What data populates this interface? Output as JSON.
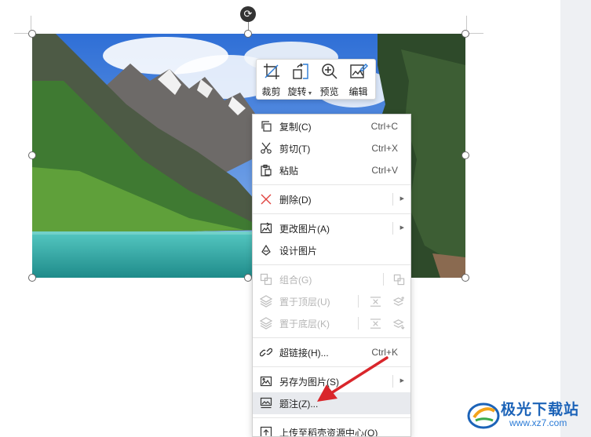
{
  "toolbar": {
    "buttons": [
      {
        "label": "裁剪",
        "icon": "crop-icon"
      },
      {
        "label": "旋转",
        "icon": "rotate-icon",
        "has_dropdown": true
      },
      {
        "label": "预览",
        "icon": "zoom-icon"
      },
      {
        "label": "编辑",
        "icon": "edit-image-icon"
      }
    ]
  },
  "context_menu": {
    "items": [
      {
        "label": "复制(C)",
        "shortcut": "Ctrl+C",
        "icon": "copy-icon"
      },
      {
        "label": "剪切(T)",
        "shortcut": "Ctrl+X",
        "icon": "scissors-icon"
      },
      {
        "label": "粘贴",
        "shortcut": "Ctrl+V",
        "icon": "paste-icon"
      },
      {
        "label": "删除(D)",
        "icon": "delete-x-icon",
        "submenu": true
      },
      {
        "label": "更改图片(A)",
        "icon": "change-image-icon",
        "submenu": true
      },
      {
        "label": "设计图片",
        "icon": "design-icon"
      },
      {
        "label": "组合(G)",
        "icon": "group-icon",
        "disabled": true
      },
      {
        "label": "置于顶层(U)",
        "icon": "layers-icon",
        "disabled": true
      },
      {
        "label": "置于底层(K)",
        "icon": "layers-icon",
        "disabled": true
      },
      {
        "label": "超链接(H)...",
        "shortcut": "Ctrl+K",
        "icon": "link-icon"
      },
      {
        "label": "另存为图片(S)",
        "icon": "save-image-icon",
        "submenu": true
      },
      {
        "label": "题注(Z)...",
        "icon": "caption-icon",
        "highlighted": true
      },
      {
        "label": "上传至稻壳资源中心(Q)",
        "icon": "upload-icon"
      }
    ]
  },
  "watermark": {
    "title": "极光下载站",
    "url": "www.xz7.com"
  },
  "colors": {
    "annotation_arrow": "#d9262b",
    "highlight": "#e8eaee",
    "watermark_blue": "#1c63b8"
  }
}
